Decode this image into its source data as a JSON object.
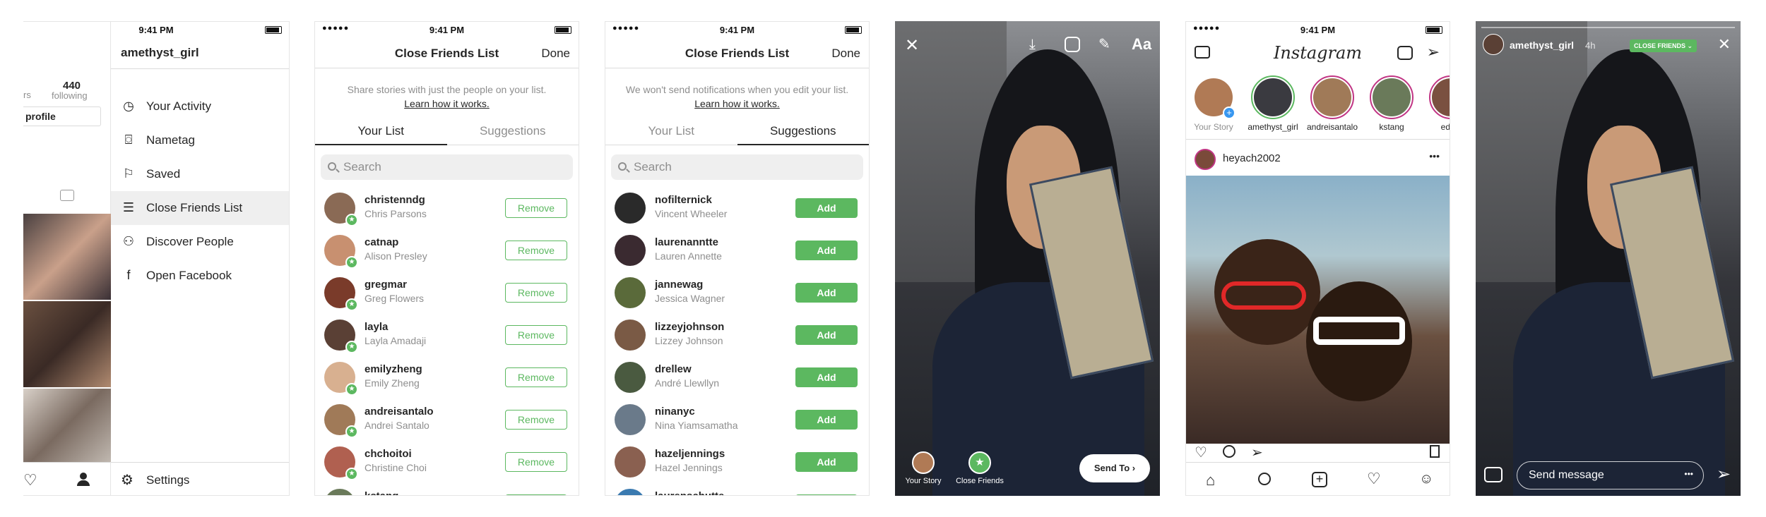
{
  "status": {
    "signal": "●●●●●",
    "time": "9:41 PM"
  },
  "profile": {
    "username": "amethyst_girl",
    "stats_partial": "rs",
    "following_count": "440",
    "following_label": "following",
    "edit_partial": "profile",
    "menu": [
      {
        "label": "Your Activity",
        "icon": "activity-clock-icon",
        "glyph": "◷"
      },
      {
        "label": "Nametag",
        "icon": "nametag-icon",
        "glyph": "⌼"
      },
      {
        "label": "Saved",
        "icon": "bookmark-icon",
        "glyph": "⚐"
      },
      {
        "label": "Close Friends List",
        "icon": "close-friends-list-icon",
        "glyph": "☰"
      },
      {
        "label": "Discover People",
        "icon": "add-person-icon",
        "glyph": "⚇"
      },
      {
        "label": "Open Facebook",
        "icon": "facebook-icon",
        "glyph": "f"
      }
    ],
    "settings_label": "Settings"
  },
  "your_list_screen": {
    "title": "Close Friends List",
    "done": "Done",
    "subtitle": "Share stories with just the people on your list.",
    "learn": "Learn how it works.",
    "tabs": [
      "Your List",
      "Suggestions"
    ],
    "search_placeholder": "Search",
    "action": "Remove",
    "people": [
      {
        "username": "christenndg",
        "name": "Chris Parsons",
        "color": "#8a6a55"
      },
      {
        "username": "catnap",
        "name": "Alison Presley",
        "color": "#c89070"
      },
      {
        "username": "gregmar",
        "name": "Greg Flowers",
        "color": "#7a3b2a"
      },
      {
        "username": "layla",
        "name": "Layla Amadaji",
        "color": "#5a4035"
      },
      {
        "username": "emilyzheng",
        "name": "Emily Zheng",
        "color": "#d8b090"
      },
      {
        "username": "andreisantalo",
        "name": "Andrei Santalo",
        "color": "#a07a58"
      },
      {
        "username": "chchoitoi",
        "name": "Christine Choi",
        "color": "#b06050"
      },
      {
        "username": "kstang",
        "name": "",
        "color": "#6a7a5a"
      }
    ]
  },
  "suggestions_screen": {
    "title": "Close Friends List",
    "done": "Done",
    "subtitle": "We won't send notifications when you edit your list.",
    "learn": "Learn how it works.",
    "tabs": [
      "Your List",
      "Suggestions"
    ],
    "search_placeholder": "Search",
    "action": "Add",
    "people": [
      {
        "username": "nofilternick",
        "name": "Vincent Wheeler",
        "color": "#2a2a2a"
      },
      {
        "username": "laurenanntte",
        "name": "Lauren Annette",
        "color": "#3a2a30"
      },
      {
        "username": "jannewag",
        "name": "Jessica Wagner",
        "color": "#5a6a3a"
      },
      {
        "username": "lizzeyjohnson",
        "name": "Lizzey Johnson",
        "color": "#7a5a45"
      },
      {
        "username": "drellew",
        "name": "André Llewllyn",
        "color": "#4a5a40"
      },
      {
        "username": "ninanyc",
        "name": "Nina Yiamsamatha",
        "color": "#6a7a8a"
      },
      {
        "username": "hazeljennings",
        "name": "Hazel Jennings",
        "color": "#8a6050"
      },
      {
        "username": "laurenschutte",
        "name": "",
        "color": "#3a7ab0"
      }
    ]
  },
  "share_screen": {
    "tool_text": "Aa",
    "audience": [
      {
        "label": "Your Story"
      },
      {
        "label": "Close Friends"
      }
    ],
    "send_to": "Send To"
  },
  "feed": {
    "logo": "Instagram",
    "stories": [
      {
        "label": "Your Story",
        "color": "#b07a55"
      },
      {
        "label": "amethyst_girl",
        "color": "#3a3a40"
      },
      {
        "label": "andreisantalo",
        "color": "#a07a58"
      },
      {
        "label": "kstang",
        "color": "#6a7a5a"
      },
      {
        "label": "edsal",
        "color": "#7a5040"
      }
    ],
    "post_user": "heyach2002"
  },
  "viewer": {
    "username": "amethyst_girl",
    "time": "4h",
    "badge": "CLOSE FRIENDS",
    "message_placeholder": "Send message"
  },
  "colors": {
    "green": "#5cb860",
    "text": "#262626",
    "secondary": "#8e8e8e"
  }
}
